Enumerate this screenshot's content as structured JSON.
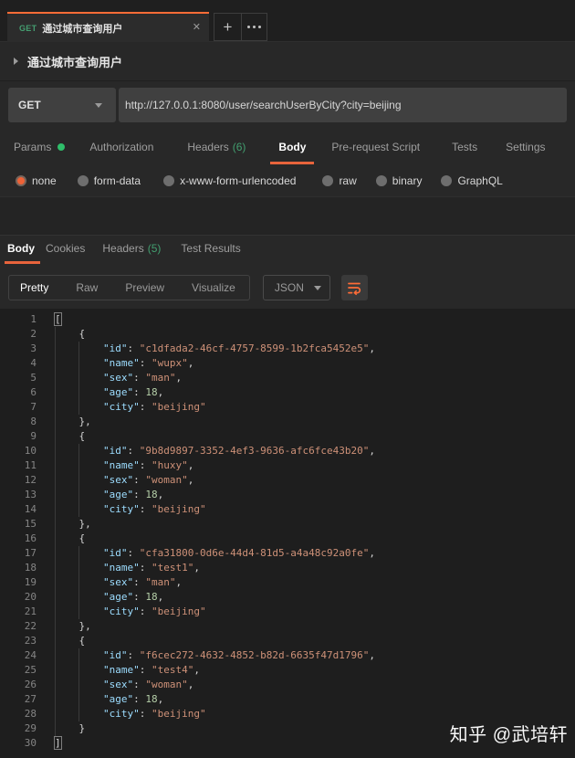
{
  "tabbar": {
    "tab": {
      "method": "GET",
      "title": "通过城市查询用户",
      "close_icon": "✕"
    }
  },
  "request": {
    "name": "通过城市查询用户",
    "method": "GET",
    "url": "http://127.0.0.1:8080/user/searchUserByCity?city=beijing",
    "tabs": [
      {
        "label": "Params",
        "indicator": "green-dot"
      },
      {
        "label": "Authorization"
      },
      {
        "label": "Headers",
        "count": "(6)"
      },
      {
        "label": "Body",
        "active": true
      },
      {
        "label": "Pre-request Script"
      },
      {
        "label": "Tests"
      },
      {
        "label": "Settings"
      }
    ],
    "body_modes": [
      {
        "label": "none",
        "selected": true
      },
      {
        "label": "form-data"
      },
      {
        "label": "x-www-form-urlencoded"
      },
      {
        "label": "raw"
      },
      {
        "label": "binary"
      },
      {
        "label": "GraphQL"
      }
    ]
  },
  "response": {
    "tabs": [
      {
        "label": "Body",
        "active": true
      },
      {
        "label": "Cookies"
      },
      {
        "label": "Headers",
        "count": "(5)"
      },
      {
        "label": "Test Results"
      }
    ],
    "view_modes": [
      {
        "label": "Pretty",
        "active": true
      },
      {
        "label": "Raw"
      },
      {
        "label": "Preview"
      },
      {
        "label": "Visualize"
      }
    ],
    "language": "JSON",
    "wrap_icon": "wrap-text",
    "line_count": 30,
    "body_json": [
      {
        "id": "c1dfada2-46cf-4757-8599-1b2fca5452e5",
        "name": "wupx",
        "sex": "man",
        "age": 18,
        "city": "beijing"
      },
      {
        "id": "9b8d9897-3352-4ef3-9636-afc6fce43b20",
        "name": "huxy",
        "sex": "woman",
        "age": 18,
        "city": "beijing"
      },
      {
        "id": "cfa31800-0d6e-44d4-81d5-a4a48c92a0fe",
        "name": "test1",
        "sex": "man",
        "age": 18,
        "city": "beijing"
      },
      {
        "id": "f6cec272-4632-4852-b82d-6635f47d1796",
        "name": "test4",
        "sex": "woman",
        "age": 18,
        "city": "beijing"
      }
    ]
  },
  "watermark": "知乎 @武培轩",
  "colors": {
    "accent_orange": "#ff6c37",
    "underline_orange": "#e8643c",
    "method_green": "#459e71",
    "indicator_green": "#2fbe6a",
    "count_green": "#429e6f",
    "code_key": "#9cdcfe",
    "code_string": "#ce9178",
    "code_number": "#b5cea8",
    "code_background": "#1e1e1e"
  }
}
